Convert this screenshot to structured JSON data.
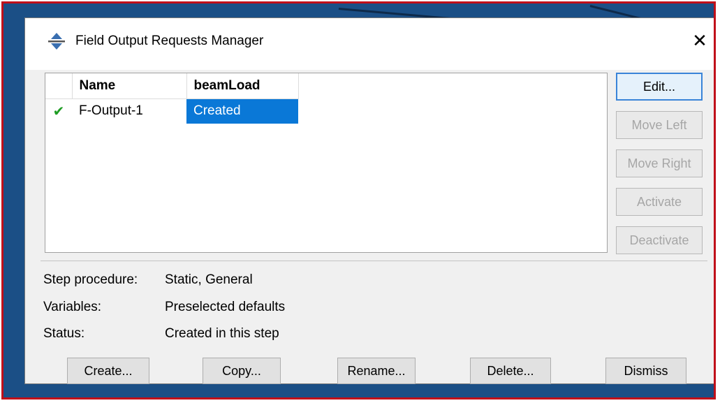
{
  "window": {
    "title": "Field Output Requests Manager",
    "close_glyph": "✕"
  },
  "table": {
    "columns": [
      "",
      "Name",
      "beamLoad"
    ],
    "rows": [
      {
        "status_icon": "checkmark-icon",
        "check_glyph": "✔",
        "name": "F-Output-1",
        "beamLoad": "Created"
      }
    ]
  },
  "side_buttons": [
    {
      "label": "Edit...",
      "enabled": true
    },
    {
      "label": "Move Left",
      "enabled": false
    },
    {
      "label": "Move Right",
      "enabled": false
    },
    {
      "label": "Activate",
      "enabled": false
    },
    {
      "label": "Deactivate",
      "enabled": false
    }
  ],
  "info": {
    "step_procedure_label": "Step procedure:",
    "step_procedure_value": "Static, General",
    "variables_label": "Variables:",
    "variables_value": "Preselected defaults",
    "status_label": "Status:",
    "status_value": "Created in this step"
  },
  "bottom_buttons": [
    "Create...",
    "Copy...",
    "Rename...",
    "Delete...",
    "Dismiss"
  ],
  "colors": {
    "accent": "#0a78d7",
    "frame": "#c0101a",
    "background": "#1b4f86",
    "check": "#1f9d24"
  }
}
